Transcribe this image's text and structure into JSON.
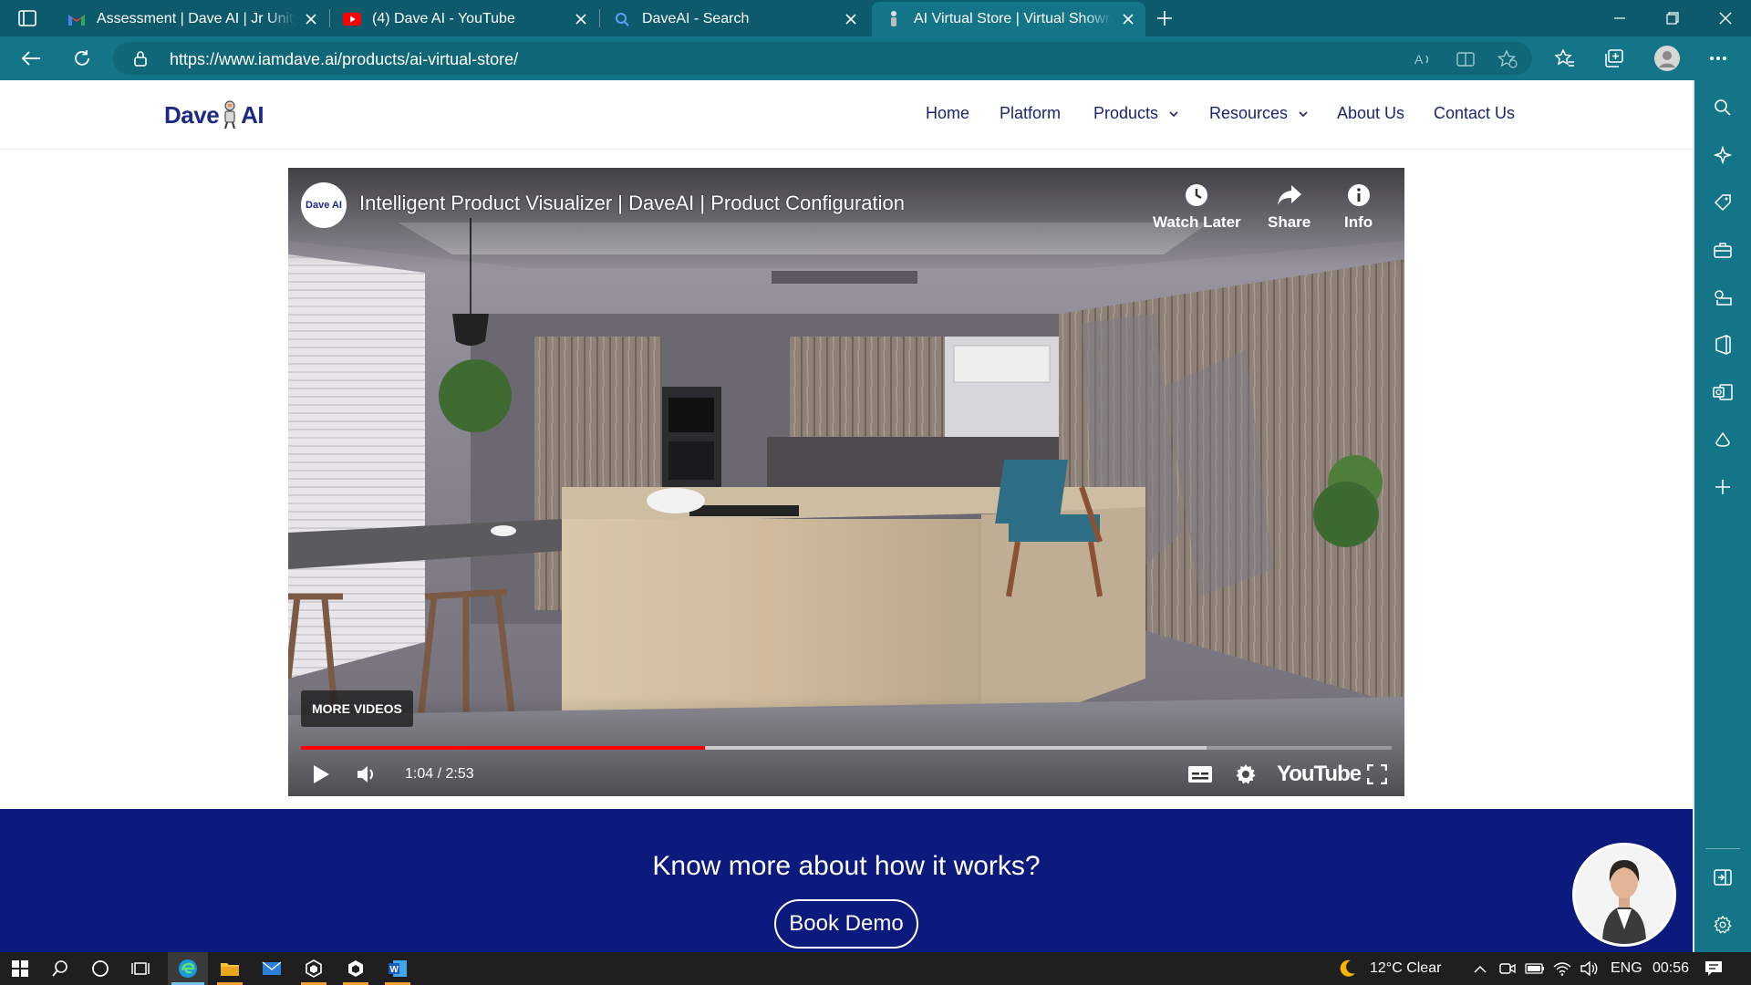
{
  "browser": {
    "tabs": [
      {
        "title": "Assessment | Dave AI | Jr Unity D",
        "icon": "gmail-icon"
      },
      {
        "title": "(4) Dave AI - YouTube",
        "icon": "youtube-icon"
      },
      {
        "title": "DaveAI - Search",
        "icon": "search-icon"
      },
      {
        "title": "AI Virtual Store | Virtual Showroo",
        "icon": "daveai-icon",
        "active": true
      }
    ],
    "url": "https://www.iamdave.ai/products/ai-virtual-store/"
  },
  "site": {
    "logo_text_left": "Dave",
    "logo_text_right": "AI",
    "nav": {
      "home": "Home",
      "platform": "Platform",
      "products": "Products",
      "resources": "Resources",
      "about": "About Us",
      "contact": "Contact Us"
    }
  },
  "video": {
    "channel_avatar_text": "Dave AI",
    "title": "Intelligent Product Visualizer | DaveAI | Product Configuration",
    "watch_later": "Watch Later",
    "share": "Share",
    "info": "Info",
    "more_videos": "MORE VIDEOS",
    "time": "1:04 / 2:53",
    "played_fraction": 0.37,
    "buffered_fraction": 0.83,
    "youtube_logo": "YouTube"
  },
  "cta": {
    "title": "Know more about how it works?",
    "button": "Book Demo"
  },
  "taskbar": {
    "weather": "12°C  Clear",
    "language": "ENG",
    "clock": "00:56"
  },
  "colors": {
    "browser_chrome": "#137587",
    "tab_strip": "#0c5a6b",
    "nav_text": "#1c2470",
    "cta_background": "#0c1a7d",
    "progress": "#ff0000"
  }
}
